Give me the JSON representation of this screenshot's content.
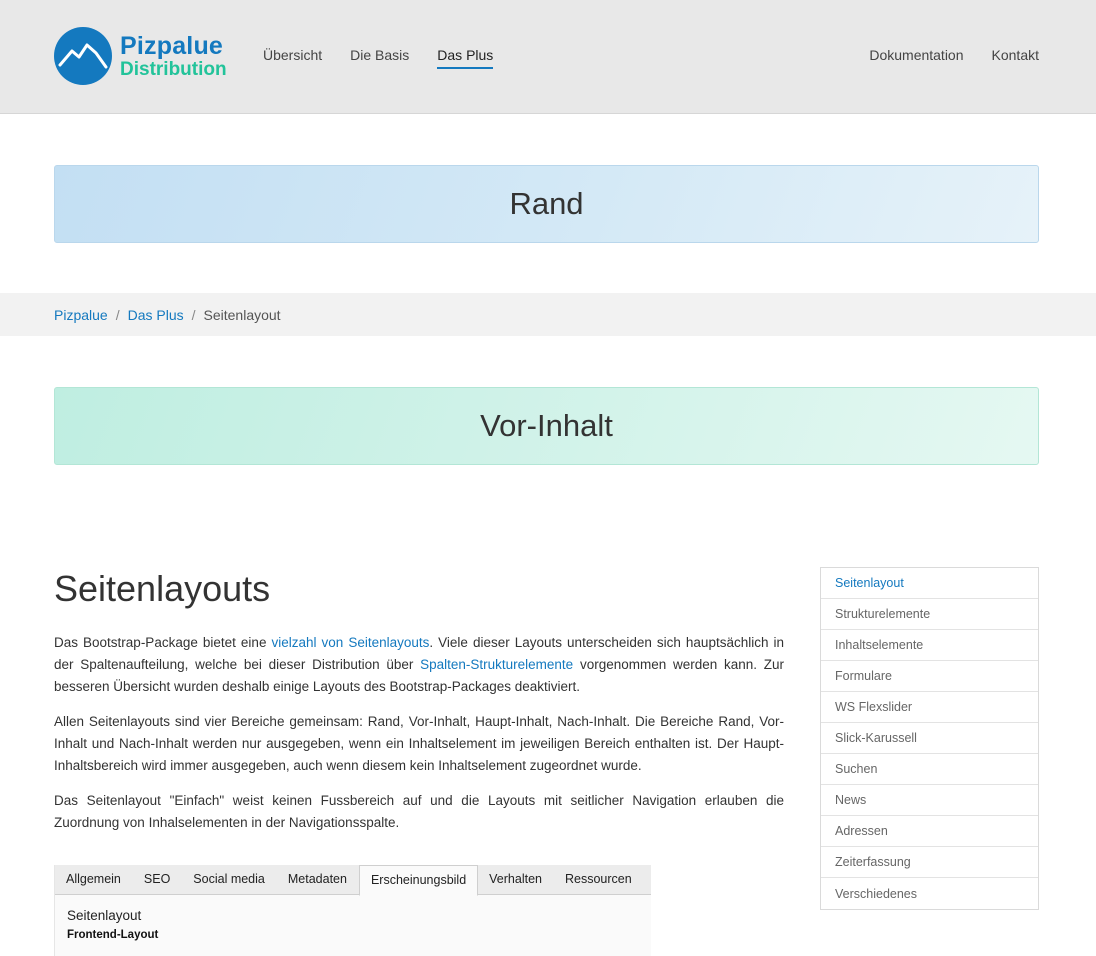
{
  "header": {
    "logo_name": "Pizpalue",
    "logo_sub": "Distribution",
    "nav_left": [
      "Übersicht",
      "Die Basis",
      "Das Plus"
    ],
    "nav_right": [
      "Dokumentation",
      "Kontakt"
    ],
    "active_nav": "Das Plus"
  },
  "banners": {
    "rand": "Rand",
    "vor_inhalt": "Vor-Inhalt"
  },
  "breadcrumb": {
    "items": [
      "Pizpalue",
      "Das Plus"
    ],
    "current": "Seitenlayout",
    "separator": "/"
  },
  "main": {
    "title": "Seitenlayouts",
    "p1": {
      "a": "Das Bootstrap-Package bietet eine ",
      "link1": "vielzahl von Seitenlayouts",
      "b": ". Viele dieser Layouts unterscheiden sich hauptsächlich in der Spaltenaufteilung, welche bei dieser Distribution über ",
      "link2": "Spalten-Strukturelemente",
      "c": " vorgenommen werden kann. Zur besseren Übersicht wurden deshalb einige Layouts des Bootstrap-Packages deaktiviert."
    },
    "p2": "Allen Seitenlayouts sind vier Bereiche gemeinsam: Rand, Vor-Inhalt, Haupt-Inhalt, Nach-Inhalt. Die Bereiche Rand, Vor-Inhalt und Nach-Inhalt werden nur ausgegeben, wenn ein Inhaltselement im jeweiligen Bereich enthalten ist. Der Haupt-Inhaltsbereich wird immer ausgegeben, auch wenn diesem kein Inhaltselement zugeordnet wurde.",
    "p3": "Das Seitenlayout \"Einfach\" weist keinen Fussbereich auf und die Layouts mit seitlicher Navigation erlauben die Zuordnung von Inhalselementen in der Navigationsspalte."
  },
  "screenshot": {
    "tabs": [
      "Allgemein",
      "SEO",
      "Social media",
      "Metadaten",
      "Erscheinungsbild",
      "Verhalten",
      "Ressourcen"
    ],
    "active_tab": "Erscheinungsbild",
    "heading": "Seitenlayout",
    "subheading": "Frontend-Layout"
  },
  "sidebar": {
    "items": [
      "Seitenlayout",
      "Strukturelemente",
      "Inhaltselemente",
      "Formulare",
      "WS Flexslider",
      "Slick-Karussell",
      "Suchen",
      "News",
      "Adressen",
      "Zeiterfassung",
      "Verschiedenes"
    ],
    "active": "Seitenlayout"
  },
  "colors": {
    "brand_blue": "#1479bf",
    "brand_green": "#22c39a"
  }
}
